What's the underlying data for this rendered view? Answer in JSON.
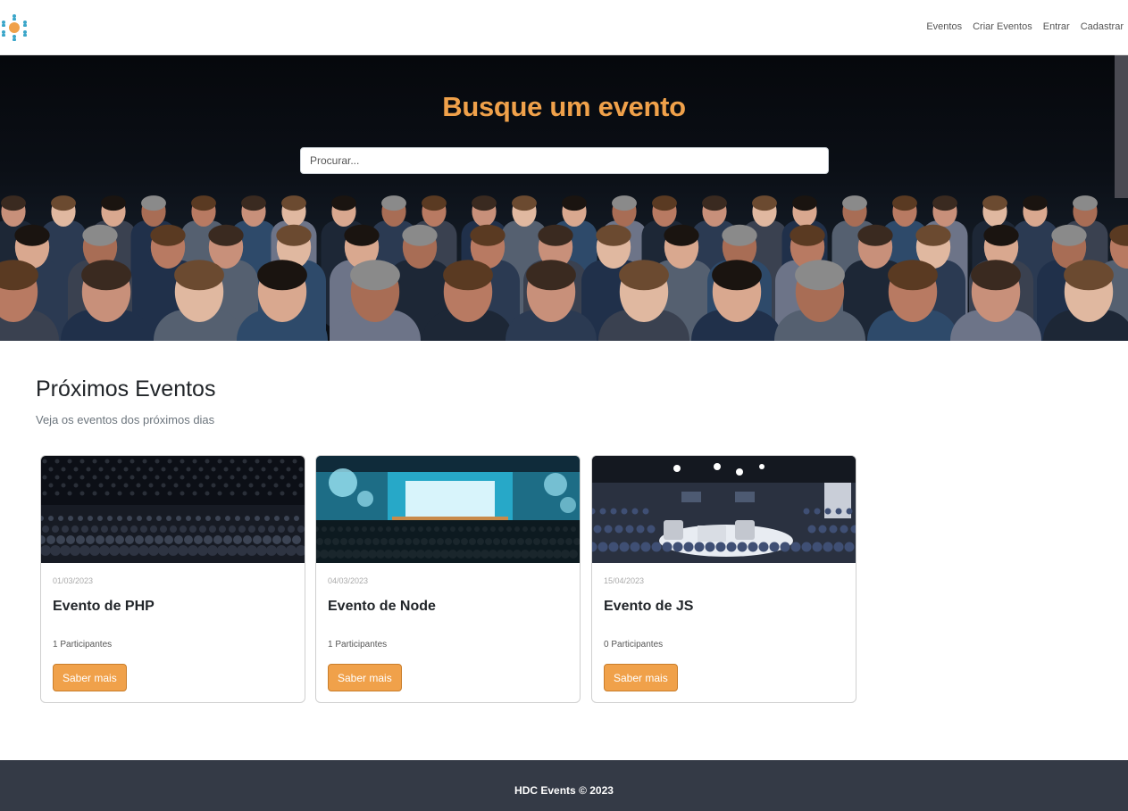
{
  "nav": {
    "logo_icon": "people-network-icon",
    "links": [
      "Eventos",
      "Criar Eventos",
      "Entrar",
      "Cadastrar"
    ]
  },
  "hero": {
    "title": "Busque um evento",
    "search_placeholder": "Procurar...",
    "search_value": "",
    "image_icon": "conference-audience-photo"
  },
  "section": {
    "title": "Próximos Eventos",
    "subtitle": "Veja os eventos dos próximos dias"
  },
  "events": [
    {
      "date": "01/03/2023",
      "title": "Evento de PHP",
      "participants": "1 Participantes",
      "button": "Saber mais",
      "image_icon": "dark-auditorium-photo"
    },
    {
      "date": "04/03/2023",
      "title": "Evento de Node",
      "participants": "1 Participantes",
      "button": "Saber mais",
      "image_icon": "blue-theater-stage-photo"
    },
    {
      "date": "15/04/2023",
      "title": "Evento de JS",
      "participants": "0 Participantes",
      "button": "Saber mais",
      "image_icon": "panel-discussion-photo"
    }
  ],
  "footer": {
    "text": "HDC Events © 2023"
  },
  "colors": {
    "accent": "#f0a14a",
    "footer_bg": "#343a46",
    "logo_blue": "#3aa6c9",
    "logo_orange": "#f0a14a"
  }
}
